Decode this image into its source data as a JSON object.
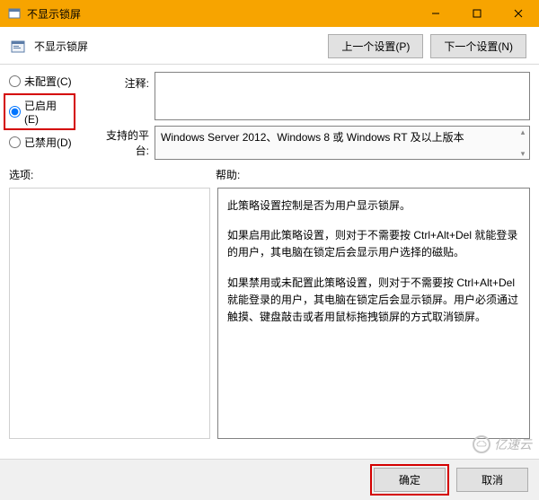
{
  "window": {
    "title": "不显示锁屏",
    "min_icon": "minimize",
    "max_icon": "maximize",
    "close_icon": "close"
  },
  "header": {
    "policy_title": "不显示锁屏",
    "prev_btn": "上一个设置(P)",
    "next_btn": "下一个设置(N)"
  },
  "state": {
    "not_configured": "未配置(C)",
    "enabled": "已启用(E)",
    "disabled": "已禁用(D)",
    "selected": "enabled"
  },
  "labels": {
    "comment": "注释:",
    "supported": "支持的平台:",
    "options": "选项:",
    "help": "帮助:"
  },
  "supported_text": "Windows Server 2012、Windows 8 或 Windows RT 及以上版本",
  "help_text": {
    "p1": "此策略设置控制是否为用户显示锁屏。",
    "p2": "如果启用此策略设置，则对于不需要按 Ctrl+Alt+Del 就能登录的用户，其电脑在锁定后会显示用户选择的磁贴。",
    "p3": "如果禁用或未配置此策略设置，则对于不需要按 Ctrl+Alt+Del 就能登录的用户，其电脑在锁定后会显示锁屏。用户必须通过触摸、键盘敲击或者用鼠标拖拽锁屏的方式取消锁屏。"
  },
  "buttons": {
    "ok": "确定",
    "cancel": "取消"
  },
  "watermark": "亿速云"
}
